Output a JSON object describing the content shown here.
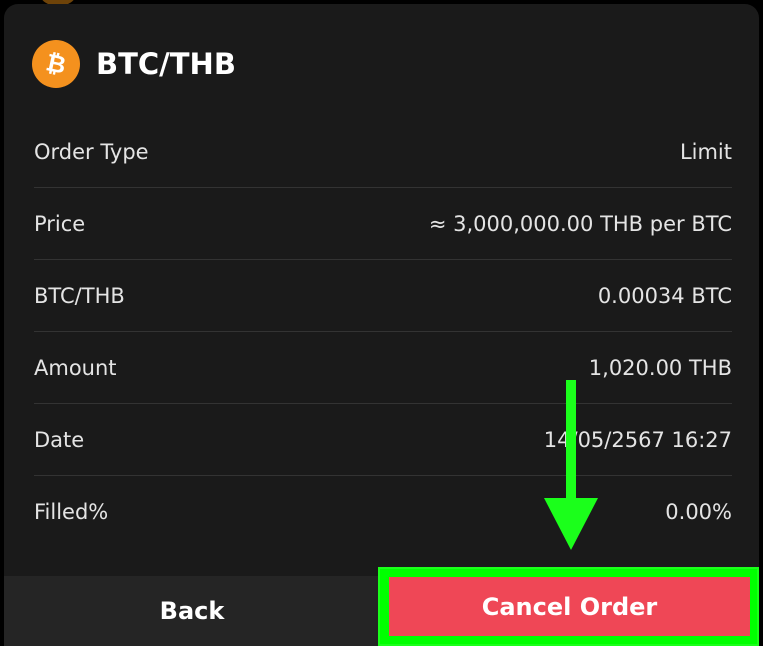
{
  "header": {
    "coin_symbol": "₿",
    "coin_icon": "bitcoin-icon",
    "pair": "BTC/THB"
  },
  "details": [
    {
      "label": "Order Type",
      "value": "Limit"
    },
    {
      "label": "Price",
      "value": "≈ 3,000,000.00 THB per BTC"
    },
    {
      "label": "BTC/THB",
      "value": "0.00034 BTC"
    },
    {
      "label": "Amount",
      "value": "1,020.00 THB"
    },
    {
      "label": "Date",
      "value": "14/05/2567 16:27"
    },
    {
      "label": "Filled%",
      "value": "0.00%"
    }
  ],
  "footer": {
    "back_label": "Back",
    "cancel_label": "Cancel Order"
  },
  "colors": {
    "coin": "#f4911e",
    "cancel": "#ef4756",
    "highlight": "#00ff00",
    "card_bg": "#1a1a1a"
  }
}
